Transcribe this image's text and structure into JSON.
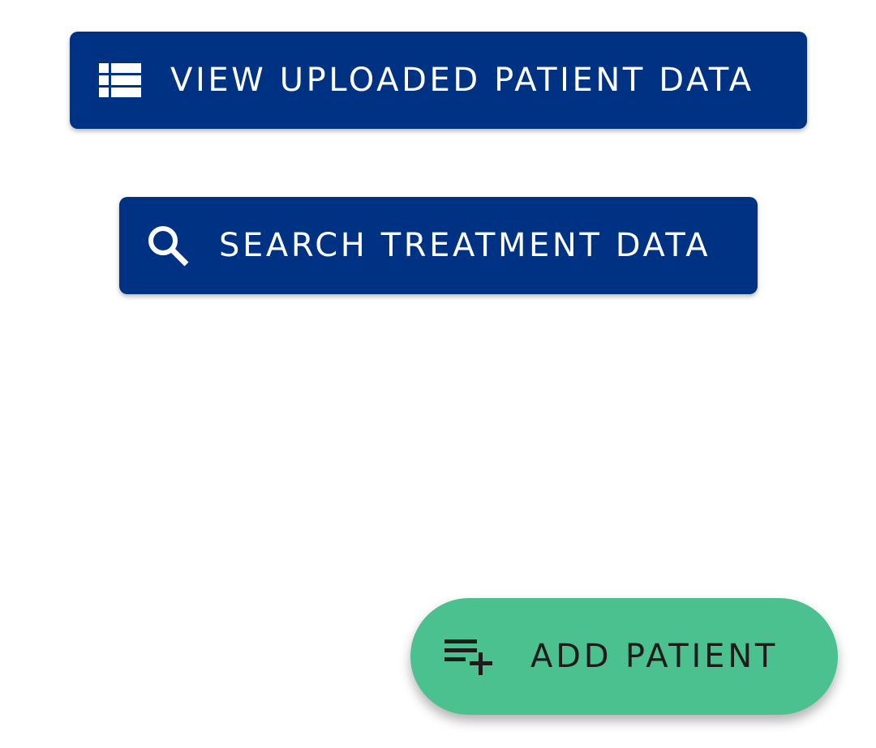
{
  "buttons": {
    "view_patient_data": {
      "label": "VIEW UPLOADED PATIENT DATA",
      "icon": "view-list-icon"
    },
    "search_treatment_data": {
      "label": "SEARCH TREATMENT DATA",
      "icon": "search-icon"
    },
    "add_patient": {
      "label": "ADD PATIENT",
      "icon": "playlist-add-icon"
    }
  },
  "colors": {
    "primary_button": "#003284",
    "fab": "#4bc190",
    "primary_text": "#ffffff",
    "fab_text": "#1c1c1c"
  }
}
